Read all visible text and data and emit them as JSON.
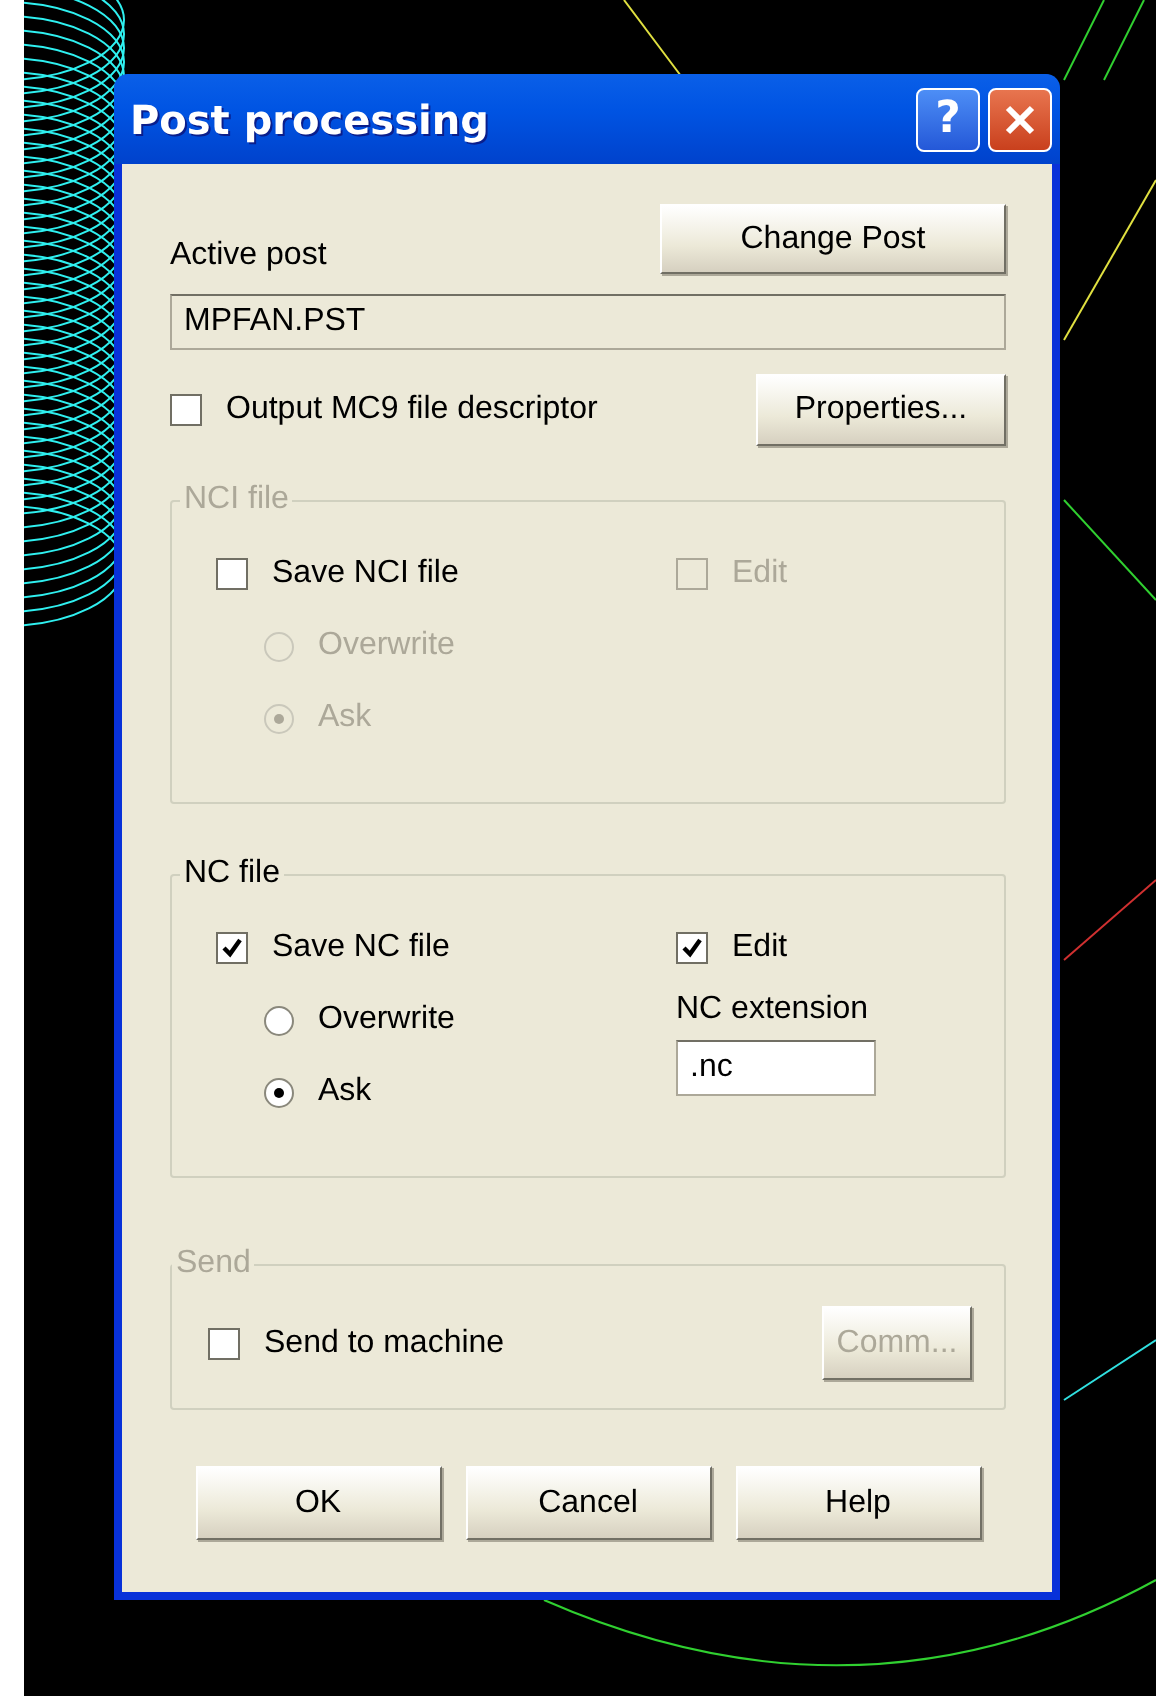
{
  "window": {
    "title": "Post processing",
    "help_glyph": "?"
  },
  "active_post": {
    "label": "Active post",
    "value": "MPFAN.PST",
    "button": "Change Post"
  },
  "output_descriptor": {
    "label": "Output MC9 file descriptor",
    "checked": false,
    "disabled": false
  },
  "properties_button": {
    "label": "Properties...",
    "disabled": false
  },
  "nci_group": {
    "title": "NCI file",
    "disabled": true,
    "save": {
      "label": "Save NCI file",
      "checked": false,
      "disabled": false
    },
    "edit": {
      "label": "Edit",
      "checked": false,
      "disabled": true
    },
    "radios": [
      {
        "label": "Overwrite",
        "selected": false,
        "disabled": true
      },
      {
        "label": "Ask",
        "selected": true,
        "disabled": true
      }
    ]
  },
  "nc_group": {
    "title": "NC file",
    "disabled": false,
    "save": {
      "label": "Save NC file",
      "checked": true,
      "disabled": false
    },
    "edit": {
      "label": "Edit",
      "checked": true,
      "disabled": false
    },
    "radios": [
      {
        "label": "Overwrite",
        "selected": false,
        "disabled": false
      },
      {
        "label": "Ask",
        "selected": true,
        "disabled": false
      }
    ],
    "extension": {
      "label": "NC extension",
      "value": ".nc"
    }
  },
  "send_group": {
    "title": "Send",
    "disabled": true,
    "send": {
      "label": "Send to machine",
      "checked": false,
      "disabled": false
    },
    "comm_button": {
      "label": "Comm...",
      "disabled": true
    }
  },
  "buttons": [
    {
      "label": "OK"
    },
    {
      "label": "Cancel"
    },
    {
      "label": "Help"
    }
  ]
}
